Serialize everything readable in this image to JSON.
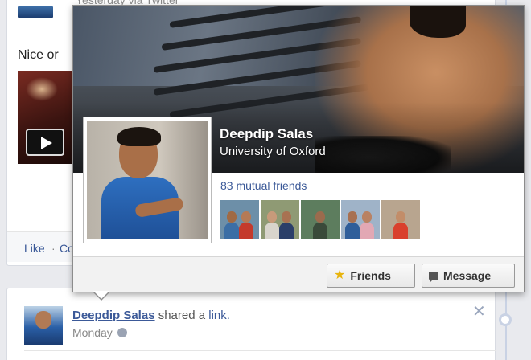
{
  "feed": {
    "top_story": {
      "via_text": "Yesterday via Twitter",
      "text_snippet": "Nice or",
      "actions": {
        "like": "Like",
        "separator": "·",
        "comment": "Co"
      }
    },
    "bottom_story": {
      "author": "Deepdip Salas",
      "action_text": "shared a",
      "link_text": "link.",
      "time": "Monday",
      "close": "✕"
    }
  },
  "hovercard": {
    "name": "Deepdip Salas",
    "subtitle": "University of Oxford",
    "mutual_friends": "83 mutual friends",
    "mutual_friend_thumbs": [
      {
        "bg": "#6d8fa8",
        "people": [
          "#a06a44",
          "#b57a56"
        ],
        "shirts": [
          "#3b6ea5",
          "#c43a2c"
        ]
      },
      {
        "bg": "#8f9a74",
        "people": [
          "#c79a7a",
          "#a87252"
        ],
        "shirts": [
          "#d8d4cc",
          "#2b3f69"
        ]
      },
      {
        "bg": "#5d7d5e",
        "people": [
          "#9b6b4d"
        ],
        "shirts": [
          "#3a4a3a"
        ]
      },
      {
        "bg": "#9fb3c8",
        "people": [
          "#a87152",
          "#b98263"
        ],
        "shirts": [
          "#2f5e9a",
          "#e2a8b4"
        ]
      },
      {
        "bg": "#b8a58f",
        "people": [
          "#c28d69"
        ],
        "shirts": [
          "#d9402d"
        ]
      }
    ],
    "buttons": {
      "friends": "Friends",
      "message": "Message"
    }
  },
  "colors": {
    "link": "#3b5998",
    "star": "#e8b40d"
  },
  "icons": {
    "friends_button": "star-icon",
    "message_button": "message-icon",
    "privacy": "globe-icon",
    "close": "close-icon",
    "play": "play-icon"
  }
}
